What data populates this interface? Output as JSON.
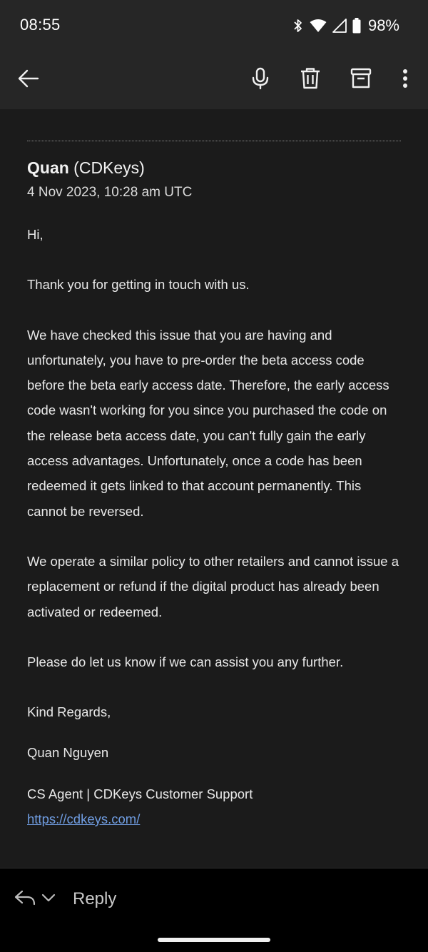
{
  "status_bar": {
    "time": "08:55",
    "battery_percent": "98%",
    "icons": [
      "bluetooth-icon",
      "wifi-icon",
      "cell-signal-icon",
      "battery-icon"
    ]
  },
  "toolbar": {
    "icons": [
      "back-arrow-icon",
      "microphone-icon",
      "trash-icon",
      "archive-icon",
      "more-vert-icon"
    ]
  },
  "email": {
    "sender_name": "Quan",
    "sender_org": " (CDKeys)",
    "date": "4 Nov 2023, 10:28 am UTC",
    "greeting": "Hi,",
    "paragraphs": [
      "Thank you for getting in touch with us.",
      "We have checked this issue that you are having and unfortunately, you have to pre-order the beta access code before the beta early access date. Therefore, the early access code wasn't working for you since you purchased the code on the release beta access date, you can't fully gain the early access advantages. Unfortunately, once a code has been redeemed it gets linked to that account permanently. This cannot be reversed.",
      "We operate a similar policy to other retailers and cannot issue a replacement or refund if the digital product has already been activated or redeemed.",
      "Please do let us know if we can assist you any further."
    ],
    "closing": "Kind Regards,",
    "signature_name": "Quan Nguyen",
    "signature_title": "CS Agent | CDKeys Customer Support",
    "signature_link": "https://cdkeys.com/"
  },
  "bottom_bar": {
    "reply_label": "Reply"
  },
  "colors": {
    "background": "#1b1b1b",
    "toolbar": "#262626",
    "text": "#e8e8e8",
    "link": "#6f9ce0"
  }
}
